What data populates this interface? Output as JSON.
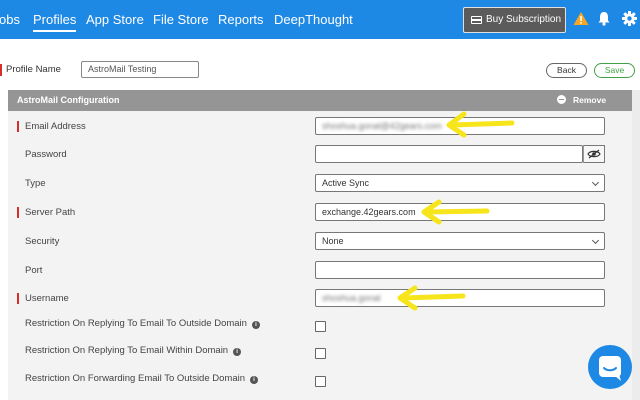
{
  "nav": {
    "items": [
      "obs",
      "Profiles",
      "App Store",
      "File Store",
      "Reports",
      "DeepThought"
    ],
    "active": "Profiles",
    "buy_label": "Buy Subscription"
  },
  "icons": {
    "card": "credit-card-icon",
    "warning": "warning-triangle-icon",
    "bell": "bell-icon",
    "settings": "gear-icon",
    "eye": "eye-icon",
    "info": "info-icon",
    "remove": "minus-circle-icon",
    "chat": "chat-icon"
  },
  "profile": {
    "name_label": "Profile Name",
    "name_value": "AstroMail Testing",
    "back_label": "Back",
    "save_label": "Save"
  },
  "config": {
    "title": "AstroMail Configuration",
    "remove_label": "Remove",
    "fields": [
      {
        "label": "Email Address",
        "required": true,
        "value": "shoshua.gonal@42gears.com",
        "blurred": true
      },
      {
        "label": "Password",
        "required": false,
        "value": ""
      },
      {
        "label": "Type",
        "required": false,
        "value": "Active Sync"
      },
      {
        "label": "Server Path",
        "required": true,
        "value": "exchange.42gears.com"
      },
      {
        "label": "Security",
        "required": false,
        "value": "None"
      },
      {
        "label": "Port",
        "required": false,
        "value": ""
      },
      {
        "label": "Username",
        "required": true,
        "value": "shoshua.gonal",
        "blurred": true
      }
    ],
    "restrictions": [
      "Restriction On Replying To Email To Outside Domain",
      "Restriction On Replying To Email Within Domain",
      "Restriction On Forwarding Email To Outside Domain"
    ],
    "info_glyph": "i"
  },
  "colors": {
    "nav_bg": "#1e88e5",
    "required_marker": "#d32f2f",
    "annotation_arrow": "#f7e51b",
    "save_green": "#43a047",
    "warning": "#f5a623"
  }
}
